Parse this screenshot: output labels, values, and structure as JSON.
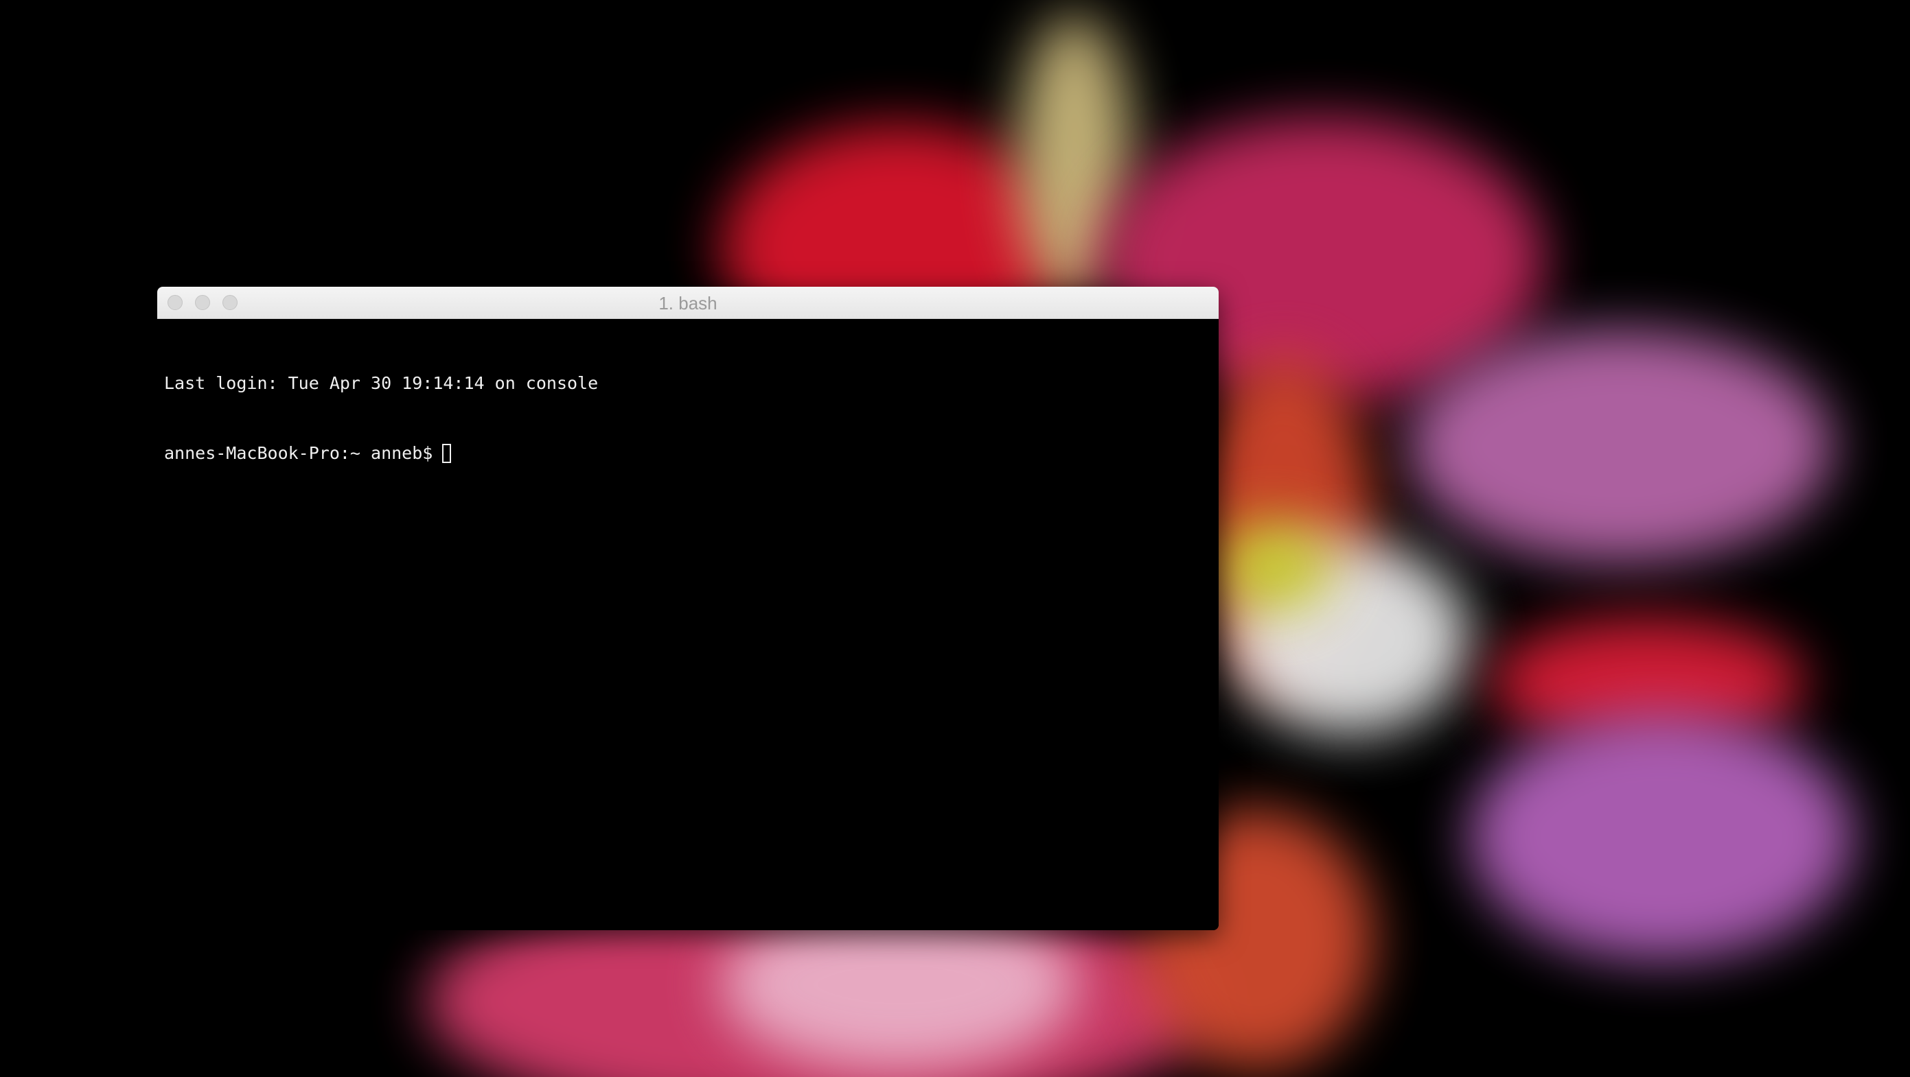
{
  "window": {
    "title": "1. bash"
  },
  "terminal": {
    "lines": [
      "Last login: Tue Apr 30 19:14:14 on console",
      "annes-MacBook-Pro:~ anneb$"
    ]
  },
  "colors": {
    "terminal_background": "#000000",
    "terminal_text": "#f0f0f0",
    "titlebar": "#ececec",
    "title_text": "#9a9a9a"
  }
}
